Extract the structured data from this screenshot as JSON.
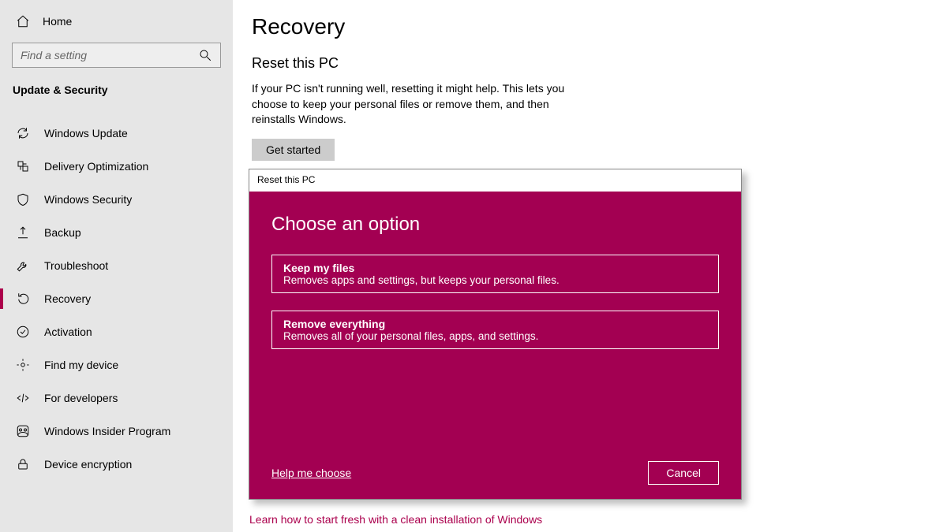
{
  "sidebar": {
    "home": "Home",
    "search_placeholder": "Find a setting",
    "section": "Update & Security",
    "items": [
      {
        "label": "Windows Update",
        "icon": "sync-icon"
      },
      {
        "label": "Delivery Optimization",
        "icon": "delivery-icon"
      },
      {
        "label": "Windows Security",
        "icon": "shield-icon"
      },
      {
        "label": "Backup",
        "icon": "backup-icon"
      },
      {
        "label": "Troubleshoot",
        "icon": "wrench-icon"
      },
      {
        "label": "Recovery",
        "icon": "recovery-icon"
      },
      {
        "label": "Activation",
        "icon": "check-circle-icon"
      },
      {
        "label": "Find my device",
        "icon": "find-icon"
      },
      {
        "label": "For developers",
        "icon": "developer-icon"
      },
      {
        "label": "Windows Insider Program",
        "icon": "insider-icon"
      },
      {
        "label": "Device encryption",
        "icon": "lock-icon"
      }
    ],
    "selected_index": 5
  },
  "main": {
    "title": "Recovery",
    "reset_heading": "Reset this PC",
    "reset_body": "If your PC isn't running well, resetting it might help. This lets you choose to keep your personal files or remove them, and then reinstalls Windows.",
    "get_started": "Get started",
    "learn_link": "Learn how to start fresh with a clean installation of Windows"
  },
  "dialog": {
    "titlebar": "Reset this PC",
    "heading": "Choose an option",
    "options": [
      {
        "title": "Keep my files",
        "desc": "Removes apps and settings, but keeps your personal files."
      },
      {
        "title": "Remove everything",
        "desc": "Removes all of your personal files, apps, and settings."
      }
    ],
    "help": "Help me choose",
    "cancel": "Cancel"
  },
  "colors": {
    "accent": "#a30052",
    "link": "#ab004d"
  }
}
